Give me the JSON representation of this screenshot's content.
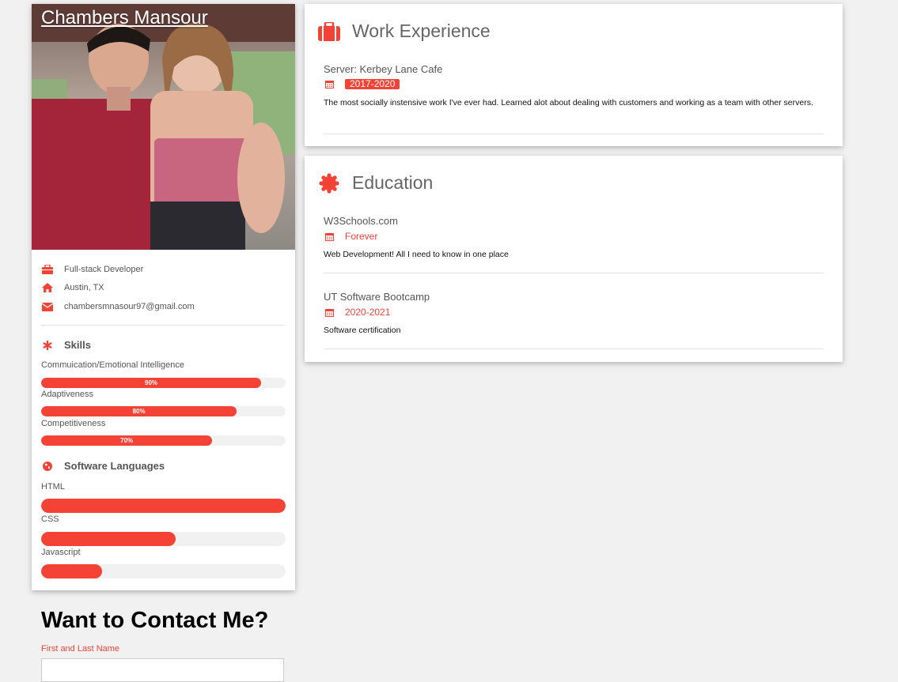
{
  "profile": {
    "name": "Chambers Mansour",
    "info": [
      {
        "icon": "briefcase-icon",
        "text": "Full-stack Developer"
      },
      {
        "icon": "home-icon",
        "text": "Austin, TX"
      },
      {
        "icon": "envelope-icon",
        "text": "chambersmnasour97@gmail.com"
      }
    ]
  },
  "skills": {
    "heading": "Skills",
    "items": [
      {
        "label": "Commuication/Emotional Intelligence",
        "percent": 90,
        "text": "90%"
      },
      {
        "label": "Adaptiveness",
        "percent": 80,
        "text": "80%"
      },
      {
        "label": "Competitiveness",
        "percent": 70,
        "text": "70%"
      }
    ]
  },
  "languages": {
    "heading": "Software Languages",
    "items": [
      {
        "label": "HTML",
        "percent": 100
      },
      {
        "label": "CSS",
        "percent": 55
      },
      {
        "label": "Javascript",
        "percent": 25
      }
    ]
  },
  "work": {
    "heading": "Work Experience",
    "entries": [
      {
        "title": "Server: Kerbey Lane Cafe",
        "date": "2017-2020",
        "description": "The most socially instensive work I've ever had. Learned alot about dealing with customers and working as a team with other servers."
      }
    ]
  },
  "education": {
    "heading": "Education",
    "entries": [
      {
        "title": "W3Schools.com",
        "date": "Forever",
        "description": "Web Development! All I need to know in one place"
      },
      {
        "title": "UT Software Bootcamp",
        "date": "2020-2021",
        "description": "Software certification"
      }
    ]
  },
  "contact": {
    "heading": "Want to Contact Me?",
    "name_label": "First and Last Name",
    "name_value": ""
  },
  "colors": {
    "accent": "#f44336",
    "background": "#f1f1f1"
  }
}
